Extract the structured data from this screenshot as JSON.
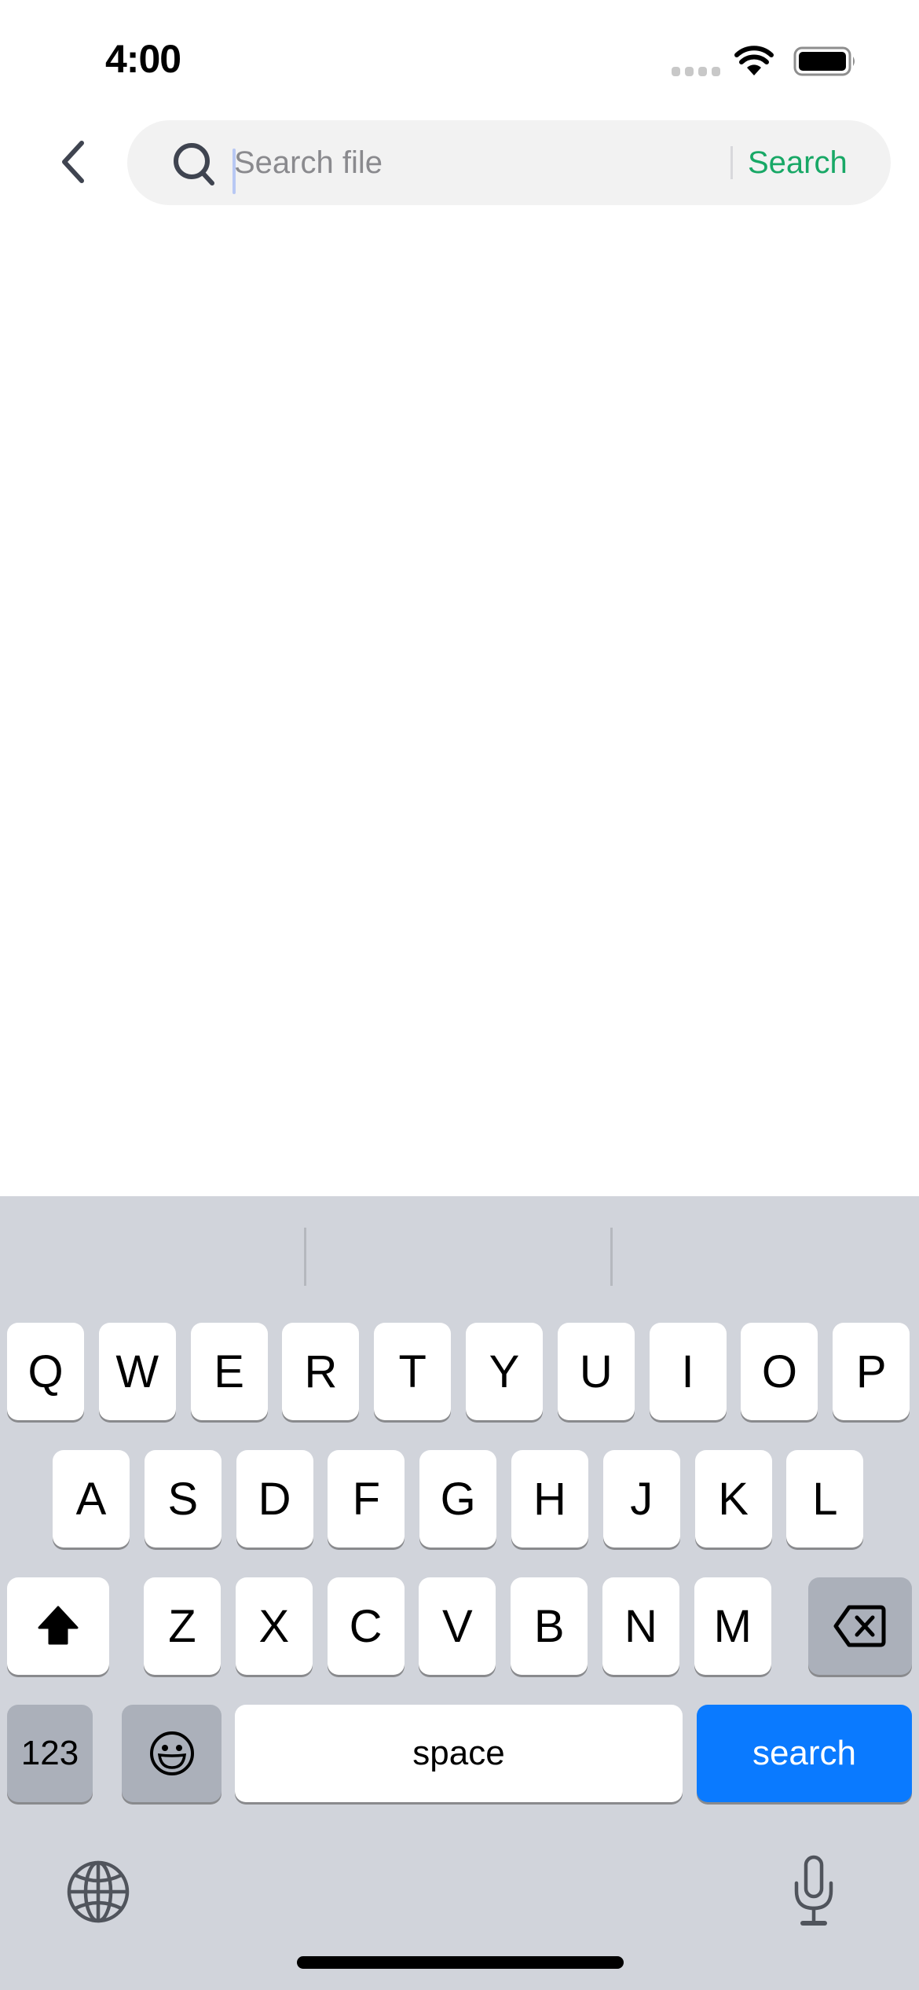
{
  "status_bar": {
    "time": "4:00",
    "icons": [
      "signal-dots-icon",
      "wifi-icon",
      "battery-icon"
    ]
  },
  "header": {
    "back_icon": "chevron-left-icon",
    "search": {
      "icon": "search-icon",
      "placeholder": "Search file",
      "value": "",
      "submit_label": "Search"
    }
  },
  "colors": {
    "accent_green": "#18a866",
    "keyboard_bg": "#d1d4db",
    "search_key": "#0a7aff",
    "search_box_bg": "#f2f2f2"
  },
  "keyboard": {
    "rows": [
      [
        "Q",
        "W",
        "E",
        "R",
        "T",
        "Y",
        "U",
        "I",
        "O",
        "P"
      ],
      [
        "A",
        "S",
        "D",
        "F",
        "G",
        "H",
        "J",
        "K",
        "L"
      ],
      [
        "Z",
        "X",
        "C",
        "V",
        "B",
        "N",
        "M"
      ]
    ],
    "shift_icon": "shift-arrow-icon",
    "delete_icon": "backspace-icon",
    "numbers_label": "123",
    "emoji_icon": "emoji-smile-icon",
    "space_label": "space",
    "return_label": "search",
    "globe_icon": "globe-icon",
    "mic_icon": "microphone-icon"
  }
}
